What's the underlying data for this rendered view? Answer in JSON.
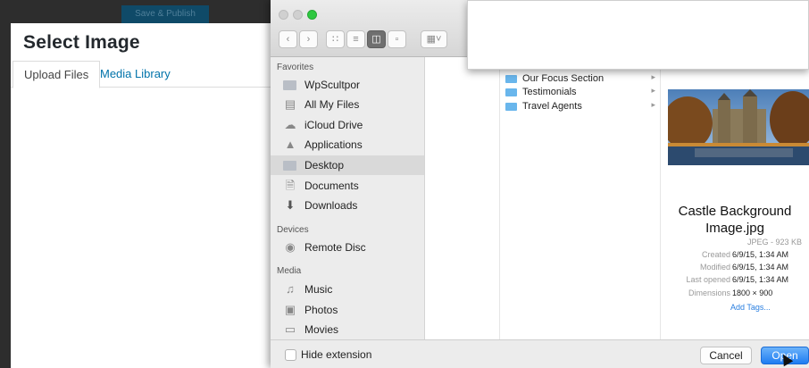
{
  "wordpress": {
    "publish_label": "Save & Publish",
    "title": "Select Image",
    "tabs": [
      {
        "label": "Upload Files",
        "active": true
      },
      {
        "label": "Media Library",
        "active": false
      }
    ]
  },
  "finder": {
    "toolbar": {
      "view_buttons": [
        "icon-view-icon",
        "list-view-icon",
        "column-view-icon",
        "cover-flow-icon"
      ],
      "selected_view": "column-view-icon"
    },
    "sidebar": {
      "favorites_heading": "Favorites",
      "favorites": [
        {
          "label": "WpScultpor",
          "icon": "folder-icon"
        },
        {
          "label": "All My Files",
          "icon": "all-files-icon"
        },
        {
          "label": "iCloud Drive",
          "icon": "cloud-icon"
        },
        {
          "label": "Applications",
          "icon": "applications-icon"
        },
        {
          "label": "Desktop",
          "icon": "desktop-icon",
          "active": true
        },
        {
          "label": "Documents",
          "icon": "documents-icon"
        },
        {
          "label": "Downloads",
          "icon": "downloads-icon"
        }
      ],
      "devices_heading": "Devices",
      "devices": [
        {
          "label": "Remote Disc",
          "icon": "disc-icon"
        }
      ],
      "media_heading": "Media",
      "media": [
        {
          "label": "Music",
          "icon": "music-icon"
        },
        {
          "label": "Photos",
          "icon": "camera-icon"
        },
        {
          "label": "Movies",
          "icon": "movies-icon"
        }
      ]
    },
    "column_items": [
      {
        "name": "Our Focus Section"
      },
      {
        "name": "Testimonials"
      },
      {
        "name": "Travel Agents"
      }
    ],
    "preview": {
      "filename_line1": "Castle Background",
      "filename_line2": "Image.jpg",
      "kind_size": "JPEG - 923 KB",
      "created_label": "Created",
      "created_value": "6/9/15, 1:34 AM",
      "modified_label": "Modified",
      "modified_value": "6/9/15, 1:34 AM",
      "last_opened_label": "Last opened",
      "last_opened_value": "6/9/15, 1:34 AM",
      "dimensions_label": "Dimensions",
      "dimensions_value": "1800 × 900",
      "add_tags": "Add Tags..."
    },
    "footer": {
      "hide_extension_label": "Hide extension",
      "hide_extension_checked": false,
      "cancel_label": "Cancel",
      "open_label": "Open"
    },
    "colors": {
      "open_button": "#1e7cf2",
      "folder_blue": "#69b6ec",
      "wp_link": "#0073aa",
      "zoom_green": "#2ec840"
    }
  }
}
